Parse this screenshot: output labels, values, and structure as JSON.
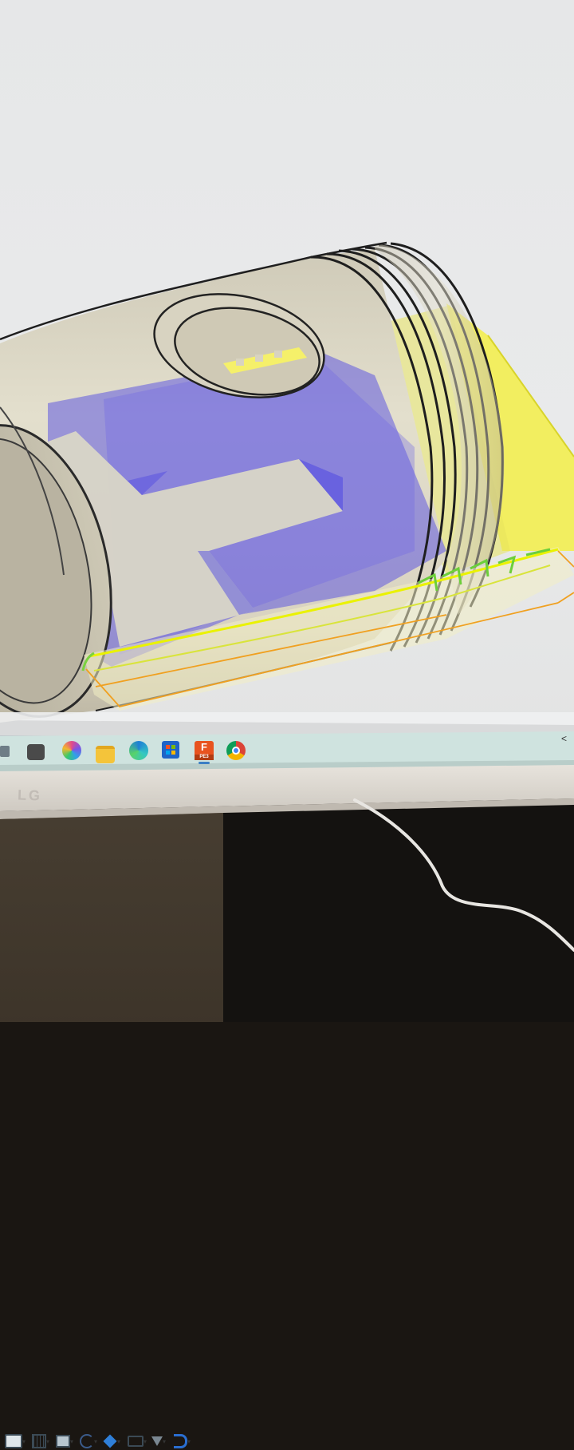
{
  "monitor": {
    "brand": "LG"
  },
  "viewport": {
    "tool": "CAD 3D viewport",
    "model": "piston",
    "section_plane_color": "#f4f04a",
    "cut_face_color": "#6f68e6",
    "body_color": "#d8d2bf"
  },
  "navigation_bar": {
    "items": [
      {
        "icon": "display-mode-icon"
      },
      {
        "icon": "visual-style-icon"
      },
      {
        "icon": "grid-icon"
      },
      {
        "icon": "orbit-icon"
      },
      {
        "icon": "section-analysis-icon"
      },
      {
        "icon": "camera-icon"
      },
      {
        "icon": "selection-filter-icon"
      },
      {
        "icon": "magnet-icon"
      }
    ],
    "collapse_glyph": "<"
  },
  "taskbar": {
    "apps": [
      {
        "name": "copilot-icon"
      },
      {
        "name": "file-explorer-icon"
      },
      {
        "name": "edge-icon"
      },
      {
        "name": "microsoft-store-icon"
      },
      {
        "name": "fusion-icon",
        "label": "F",
        "badge": "PE3"
      },
      {
        "name": "chrome-icon"
      }
    ]
  }
}
